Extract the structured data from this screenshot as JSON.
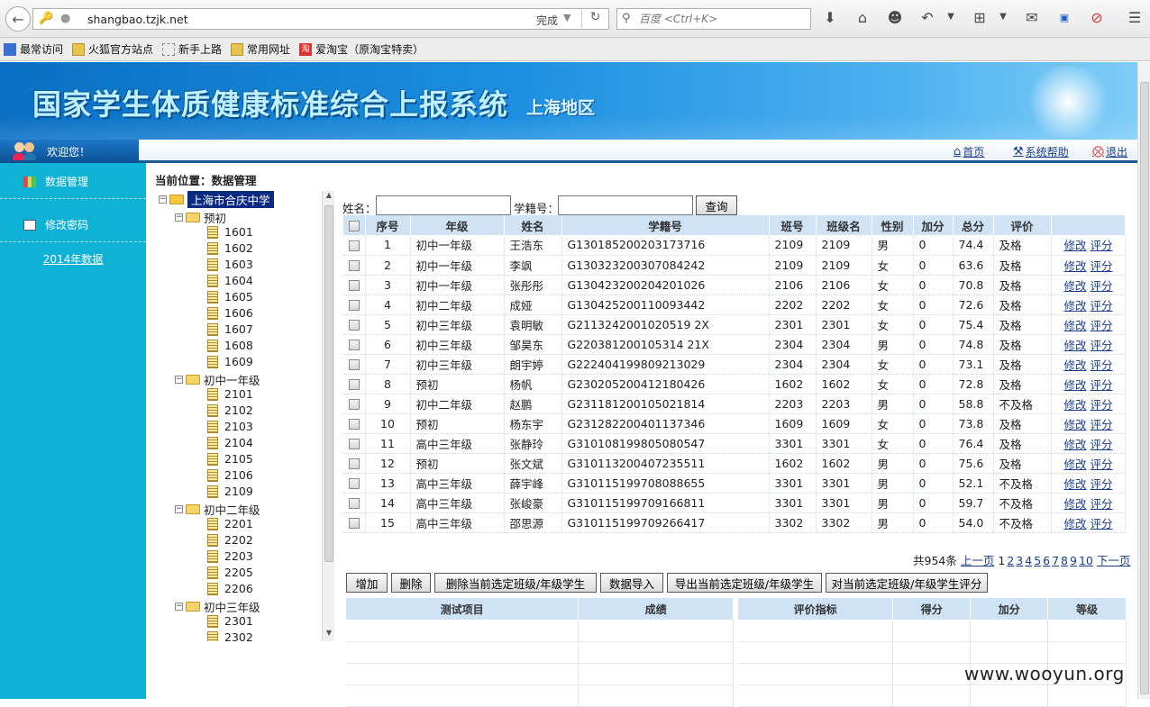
{
  "browser": {
    "url": "shangbao.tzjk.net",
    "status": "完成",
    "search_placeholder": "百度 <Ctrl+K>",
    "bookmarks": [
      "最常访问",
      "火狐官方站点",
      "新手上路",
      "常用网址",
      "爱淘宝（原淘宝特卖）"
    ]
  },
  "banner": {
    "title": "国家学生体质健康标准综合上报系统",
    "region": "上海地区"
  },
  "topbar": {
    "welcome": "欢迎您！",
    "home": "首页",
    "help": "系统帮助",
    "logout": "退出"
  },
  "sidebar": {
    "items": [
      "数据管理",
      "修改密码"
    ],
    "link": "2014年数据"
  },
  "breadcrumb": "当前位置：数据管理",
  "tree": {
    "school": "上海市合庆中学",
    "groups": [
      {
        "name": "预初",
        "classes": [
          "1601",
          "1602",
          "1603",
          "1604",
          "1605",
          "1606",
          "1607",
          "1608",
          "1609"
        ]
      },
      {
        "name": "初中一年级",
        "classes": [
          "2101",
          "2102",
          "2103",
          "2104",
          "2105",
          "2106",
          "2109"
        ]
      },
      {
        "name": "初中二年级",
        "classes": [
          "2201",
          "2202",
          "2203",
          "2205",
          "2206"
        ]
      },
      {
        "name": "初中三年级",
        "classes": [
          "2301",
          "2302"
        ]
      }
    ]
  },
  "search": {
    "name_label": "姓名：",
    "id_label": "学籍号：",
    "button": "查询"
  },
  "table": {
    "headers": [
      "序号",
      "年级",
      "姓名",
      "学籍号",
      "班号",
      "班级名",
      "性别",
      "加分",
      "总分",
      "评价",
      ""
    ],
    "actions": [
      "修改",
      "评分"
    ],
    "rows": [
      [
        "1",
        "初中一年级",
        "王浩东",
        "G130185200203173716",
        "2109",
        "2109",
        "男",
        "0",
        "74.4",
        "及格"
      ],
      [
        "2",
        "初中一年级",
        "李飒",
        "G130323200307084242",
        "2109",
        "2109",
        "女",
        "0",
        "63.6",
        "及格"
      ],
      [
        "3",
        "初中一年级",
        "张彤彤",
        "G130423200204201026",
        "2106",
        "2106",
        "女",
        "0",
        "70.8",
        "及格"
      ],
      [
        "4",
        "初中二年级",
        "成娅",
        "G130425200110093442",
        "2202",
        "2202",
        "女",
        "0",
        "72.6",
        "及格"
      ],
      [
        "5",
        "初中三年级",
        "袁明敏",
        "G2113242001020519 2X",
        "2301",
        "2301",
        "女",
        "0",
        "75.4",
        "及格"
      ],
      [
        "6",
        "初中三年级",
        "邹昊东",
        "G220381200105314 21X",
        "2304",
        "2304",
        "男",
        "0",
        "74.8",
        "及格"
      ],
      [
        "7",
        "初中三年级",
        "朗宇婷",
        "G222404199809213029",
        "2304",
        "2304",
        "女",
        "0",
        "73.1",
        "及格"
      ],
      [
        "8",
        "预初",
        "杨帆",
        "G230205200412180426",
        "1602",
        "1602",
        "女",
        "0",
        "72.8",
        "及格"
      ],
      [
        "9",
        "初中二年级",
        "赵鹏",
        "G231181200105021814",
        "2203",
        "2203",
        "男",
        "0",
        "58.8",
        "不及格"
      ],
      [
        "10",
        "预初",
        "杨东宇",
        "G231282200401137346",
        "1609",
        "1609",
        "女",
        "0",
        "73.8",
        "及格"
      ],
      [
        "11",
        "高中三年级",
        "张静玲",
        "G310108199805080547",
        "3301",
        "3301",
        "女",
        "0",
        "76.4",
        "及格"
      ],
      [
        "12",
        "预初",
        "张文斌",
        "G310113200407235511",
        "1602",
        "1602",
        "男",
        "0",
        "75.6",
        "及格"
      ],
      [
        "13",
        "高中三年级",
        "薛宇峰",
        "G310115199708088655",
        "3301",
        "3301",
        "男",
        "0",
        "52.1",
        "不及格"
      ],
      [
        "14",
        "高中三年级",
        "张峻豪",
        "G310115199709166811",
        "3301",
        "3301",
        "男",
        "0",
        "59.7",
        "不及格"
      ],
      [
        "15",
        "高中三年级",
        "邵思源",
        "G310115199709266417",
        "3302",
        "3302",
        "男",
        "0",
        "54.0",
        "不及格"
      ]
    ]
  },
  "pager": {
    "total": "共954条",
    "prev": "上一页",
    "pages": [
      "1",
      "2",
      "3",
      "4",
      "5",
      "6",
      "7",
      "8",
      "9",
      "10"
    ],
    "next": "下一页"
  },
  "actions": [
    "增加",
    "删除",
    "删除当前选定班级/年级学生",
    "数据导入",
    "导出当前选定班级/年级学生",
    "对当前选定班级/年级学生评分"
  ],
  "bottom_left_headers": [
    "测试项目",
    "成绩"
  ],
  "bottom_right_headers": [
    "评价指标",
    "得分",
    "加分",
    "等级"
  ],
  "watermark": "www.wooyun.org"
}
